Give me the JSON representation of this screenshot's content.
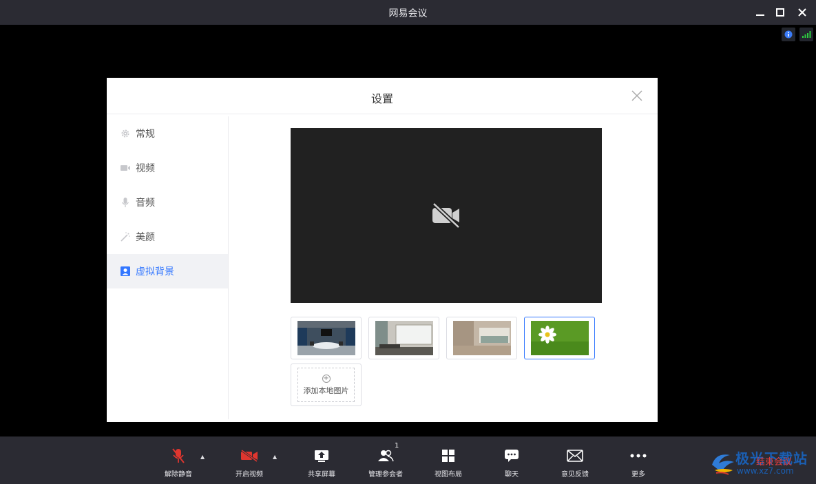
{
  "window": {
    "title": "网易会议"
  },
  "dialog": {
    "title": "设置",
    "nav": [
      {
        "label": "常规",
        "icon": "gear-icon"
      },
      {
        "label": "视频",
        "icon": "video-camera-icon"
      },
      {
        "label": "音频",
        "icon": "microphone-icon"
      },
      {
        "label": "美颜",
        "icon": "magic-wand-icon"
      },
      {
        "label": "虚拟背景",
        "icon": "portrait-icon",
        "active": true
      }
    ],
    "backgrounds": [
      {
        "name": "meeting-room"
      },
      {
        "name": "classroom-whiteboard"
      },
      {
        "name": "library-hall"
      },
      {
        "name": "daisy-on-grass",
        "selected": true
      }
    ],
    "add_label": "添加本地图片"
  },
  "toolbar": {
    "items": [
      {
        "label": "解除静音",
        "icon": "microphone-muted-icon"
      },
      {
        "label": "开启视频",
        "icon": "video-off-icon"
      },
      {
        "label": "共享屏幕",
        "icon": "share-screen-icon"
      },
      {
        "label": "管理参会者",
        "icon": "participants-icon",
        "badge": "1"
      },
      {
        "label": "视图布局",
        "icon": "grid-layout-icon"
      },
      {
        "label": "聊天",
        "icon": "chat-icon"
      },
      {
        "label": "意见反馈",
        "icon": "mail-icon"
      },
      {
        "label": "更多",
        "icon": "more-icon"
      }
    ],
    "end_label": "结束会议"
  },
  "watermark": {
    "text": "极光下载站",
    "url": "www.xz7.com"
  },
  "colors": {
    "accent": "#3377ff",
    "danger": "#e03c3c",
    "bar": "#2b2b33"
  }
}
